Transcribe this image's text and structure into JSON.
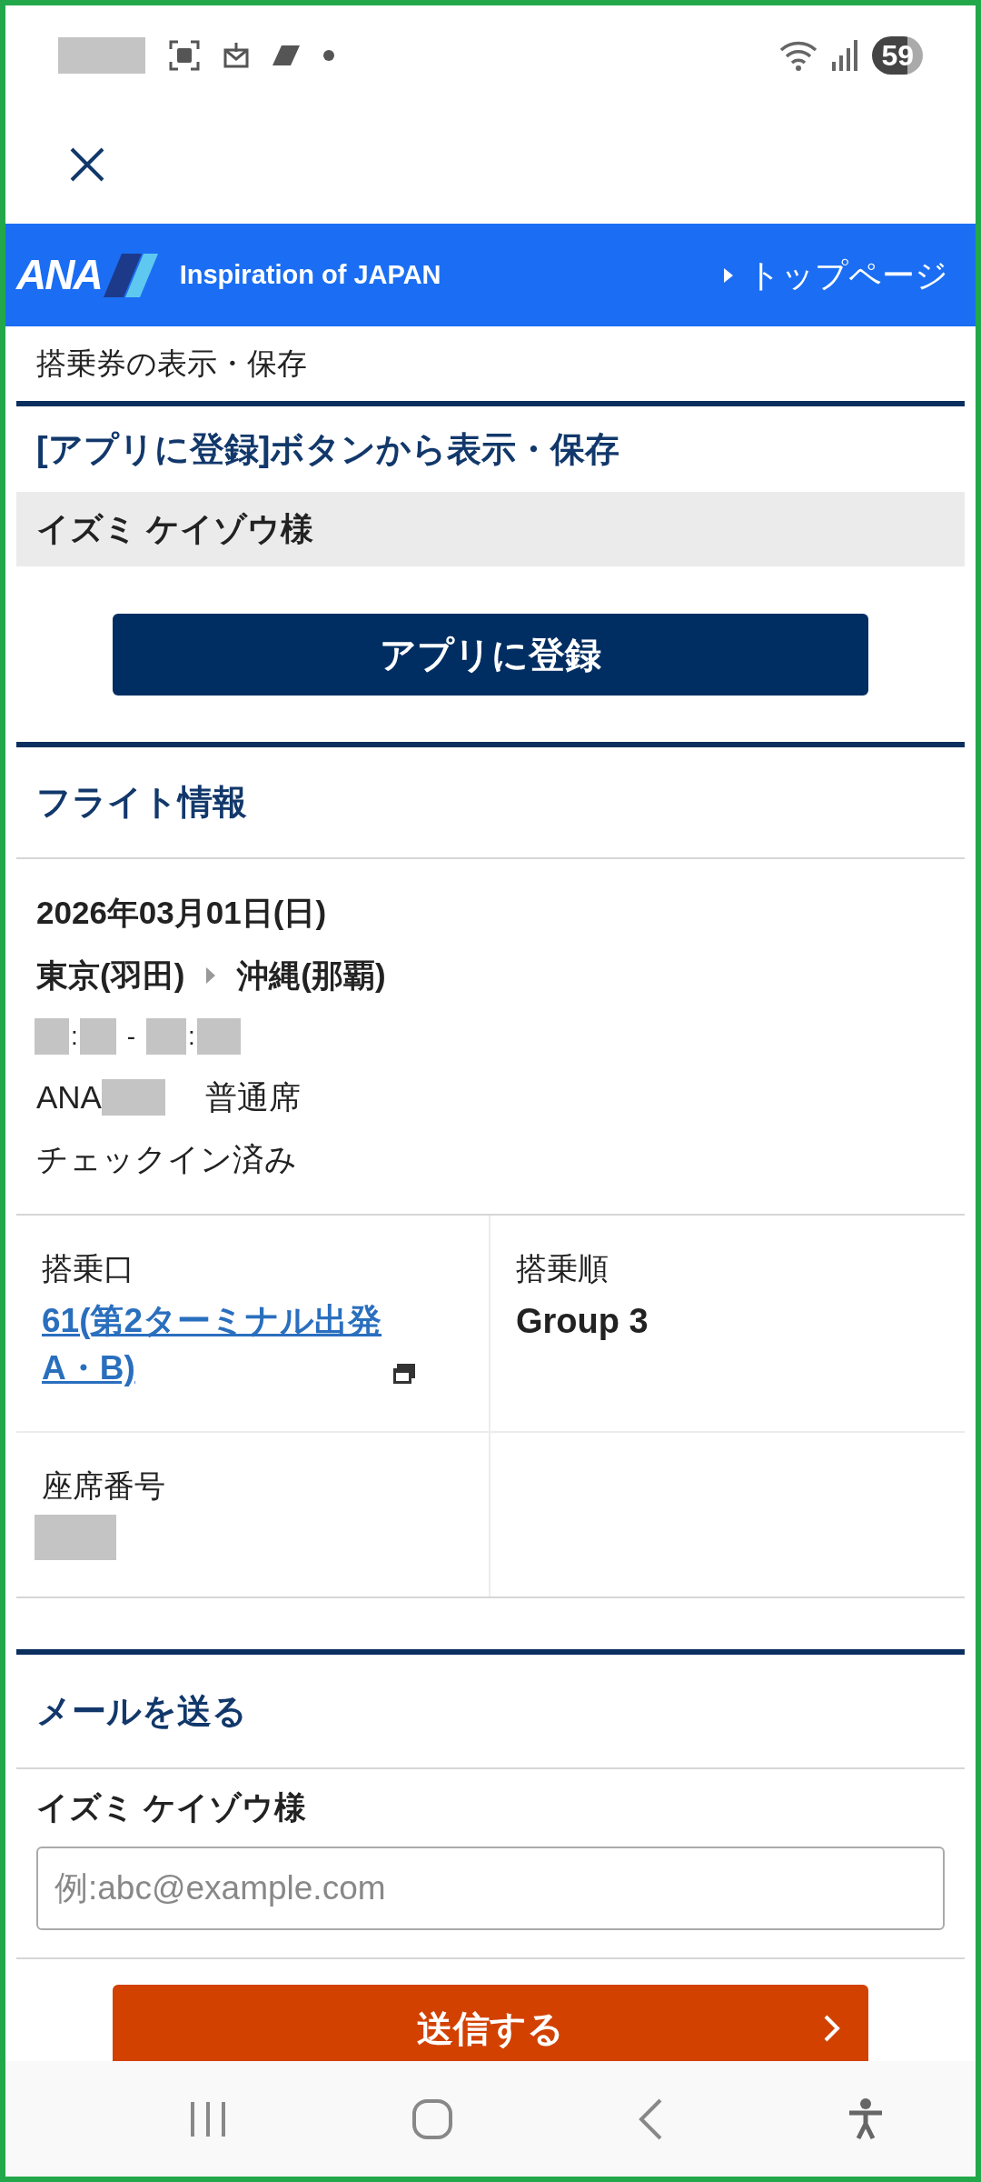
{
  "status_bar": {
    "battery": "59"
  },
  "banner": {
    "logo": "ANA",
    "tagline": "Inspiration of JAPAN",
    "top_link": "トップページ"
  },
  "breadcrumb": "搭乗券の表示・保存",
  "app_section": {
    "title": "[アプリに登録]ボタンから表示・保存",
    "passenger": "イズミ ケイゾウ様",
    "button": "アプリに登録"
  },
  "flight": {
    "title": "フライト情報",
    "date": "2026年03月01日(日)",
    "from": "東京(羽田)",
    "to": "沖縄(那覇)",
    "time_colon": ":",
    "time_dash": "-",
    "airline": "ANA",
    "cabin": "普通席",
    "status": "チェックイン済み",
    "cells": [
      {
        "kind": "link",
        "label": "搭乗口",
        "lines": [
          "61(第2ターミナル出発",
          "A・B)"
        ]
      },
      {
        "kind": "text",
        "label": "搭乗順",
        "value": "Group 3"
      },
      {
        "kind": "redacted",
        "label": "座席番号"
      },
      {
        "kind": "empty"
      }
    ]
  },
  "mail": {
    "title": "メールを送る",
    "passenger": "イズミ ケイゾウ様",
    "placeholder": "例:abc@example.com",
    "button": "送信する"
  }
}
